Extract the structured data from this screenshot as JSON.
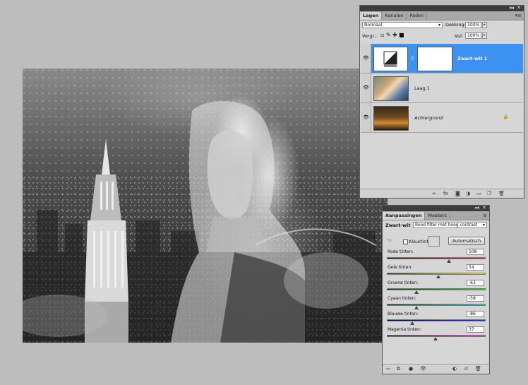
{
  "layers_panel": {
    "tabs": [
      "Lagen",
      "Kanalen",
      "Paden"
    ],
    "blend_mode": "Normaal",
    "opacity_label": "Dekking:",
    "opacity_value": "100%",
    "lock_label": "Vergr.:",
    "fill_label": "Vul:",
    "fill_value": "100%",
    "layers": [
      {
        "name": "Zwart-wit 1",
        "selected": true
      },
      {
        "name": "Laag 1",
        "selected": false
      },
      {
        "name": "Achtergrond",
        "selected": false,
        "locked": true
      }
    ]
  },
  "adjust_panel": {
    "tabs": [
      "Aanpassingen",
      "Maskers"
    ],
    "title": "Zwart-wit",
    "preset": "Rood filter met hoog contrast",
    "tint_label": "Kleurtint",
    "auto_label": "Automatisch",
    "sliders": [
      {
        "label": "Rode tinten:",
        "value": "108",
        "fraction": 0.63,
        "gradient": [
          "#3a0000",
          "#ff2020"
        ]
      },
      {
        "label": "Gele tinten:",
        "value": "54",
        "fraction": 0.52,
        "gradient": [
          "#3a3a00",
          "#ffff30"
        ]
      },
      {
        "label": "Groene tinten:",
        "value": "-63",
        "fraction": 0.3,
        "gradient": [
          "#003a00",
          "#20e020"
        ]
      },
      {
        "label": "Cyaan tinten:",
        "value": "-58",
        "fraction": 0.3,
        "gradient": [
          "#003a3a",
          "#20e0e0"
        ]
      },
      {
        "label": "Blauwe tinten:",
        "value": "-86",
        "fraction": 0.26,
        "gradient": [
          "#00003a",
          "#2020ff"
        ]
      },
      {
        "label": "Magenta tinten:",
        "value": "37",
        "fraction": 0.49,
        "gradient": [
          "#3a003a",
          "#ff30ff"
        ]
      }
    ]
  },
  "colors": {
    "selection": "#3d91f0",
    "panel_bg": "#d6d6d6",
    "workspace_bg": "#bdbdbd"
  }
}
